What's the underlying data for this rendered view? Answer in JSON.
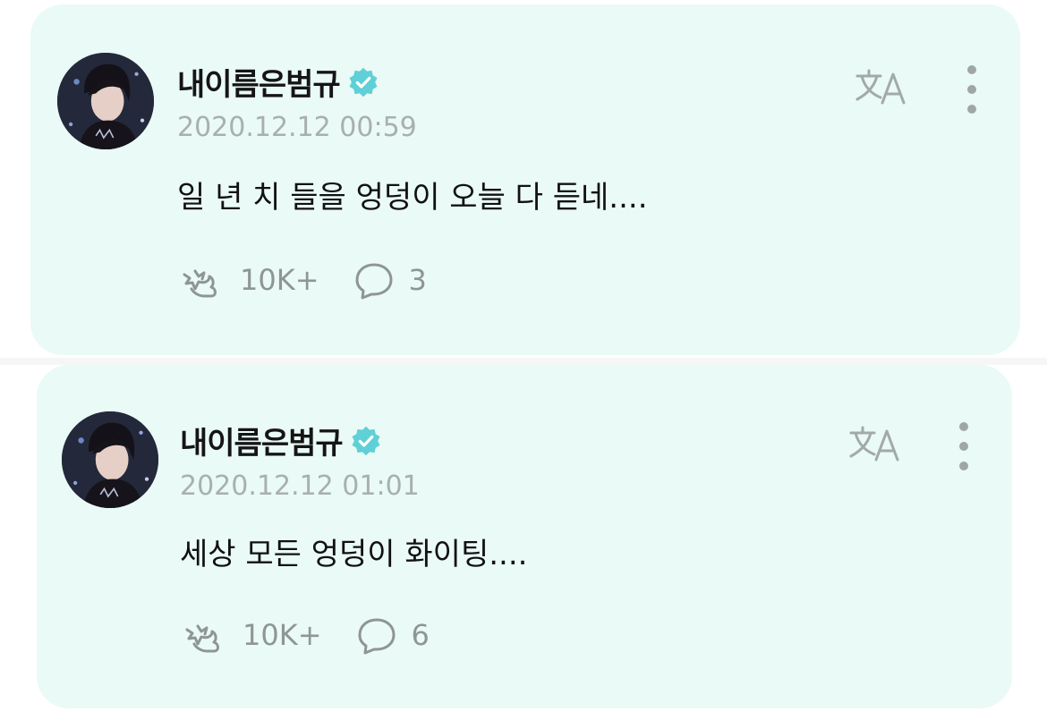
{
  "colors": {
    "card_background": "#eafaf6",
    "verified_badge": "#5fd0d6",
    "muted_text": "#a8b0ae",
    "icon_gray": "#8e9694"
  },
  "posts": [
    {
      "username": "내이름은범규",
      "verified": true,
      "timestamp": "2020.12.12 00:59",
      "text": "일 년 치 들을 엉덩이 오늘 다 듣네....",
      "likes": "10K+",
      "comments": "3",
      "icons": [
        "avatar-photo",
        "verified-badge-icon",
        "translate-icon",
        "more-options-icon",
        "like-icon",
        "comment-icon"
      ]
    },
    {
      "username": "내이름은범규",
      "verified": true,
      "timestamp": "2020.12.12 01:01",
      "text": "세상 모든 엉덩이 화이팅....",
      "likes": "10K+",
      "comments": "6",
      "icons": [
        "avatar-photo",
        "verified-badge-icon",
        "translate-icon",
        "more-options-icon",
        "like-icon",
        "comment-icon"
      ]
    }
  ]
}
